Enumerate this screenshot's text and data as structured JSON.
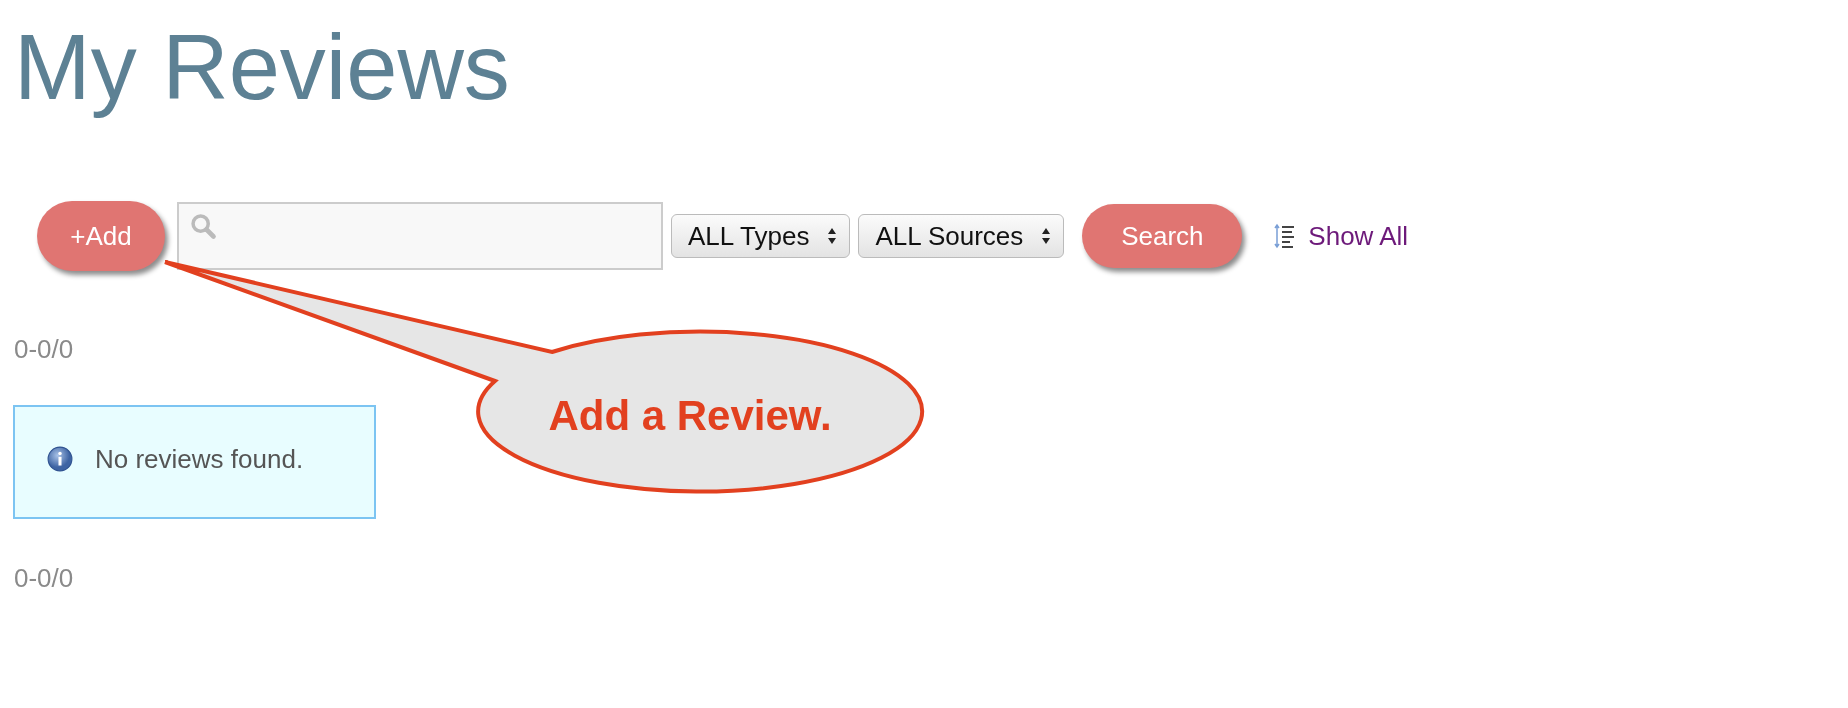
{
  "title": "My Reviews",
  "toolbar": {
    "add_button": "+Add",
    "type_filter": "ALL Types",
    "source_filter": "ALL Sources",
    "search_button": "Search",
    "show_all": "Show All"
  },
  "pagination_top": "0-0/0",
  "alert": {
    "kind": "info",
    "text": "No reviews found."
  },
  "pagination_bottom": "0-0/0",
  "callout": {
    "text": "Add a Review."
  }
}
